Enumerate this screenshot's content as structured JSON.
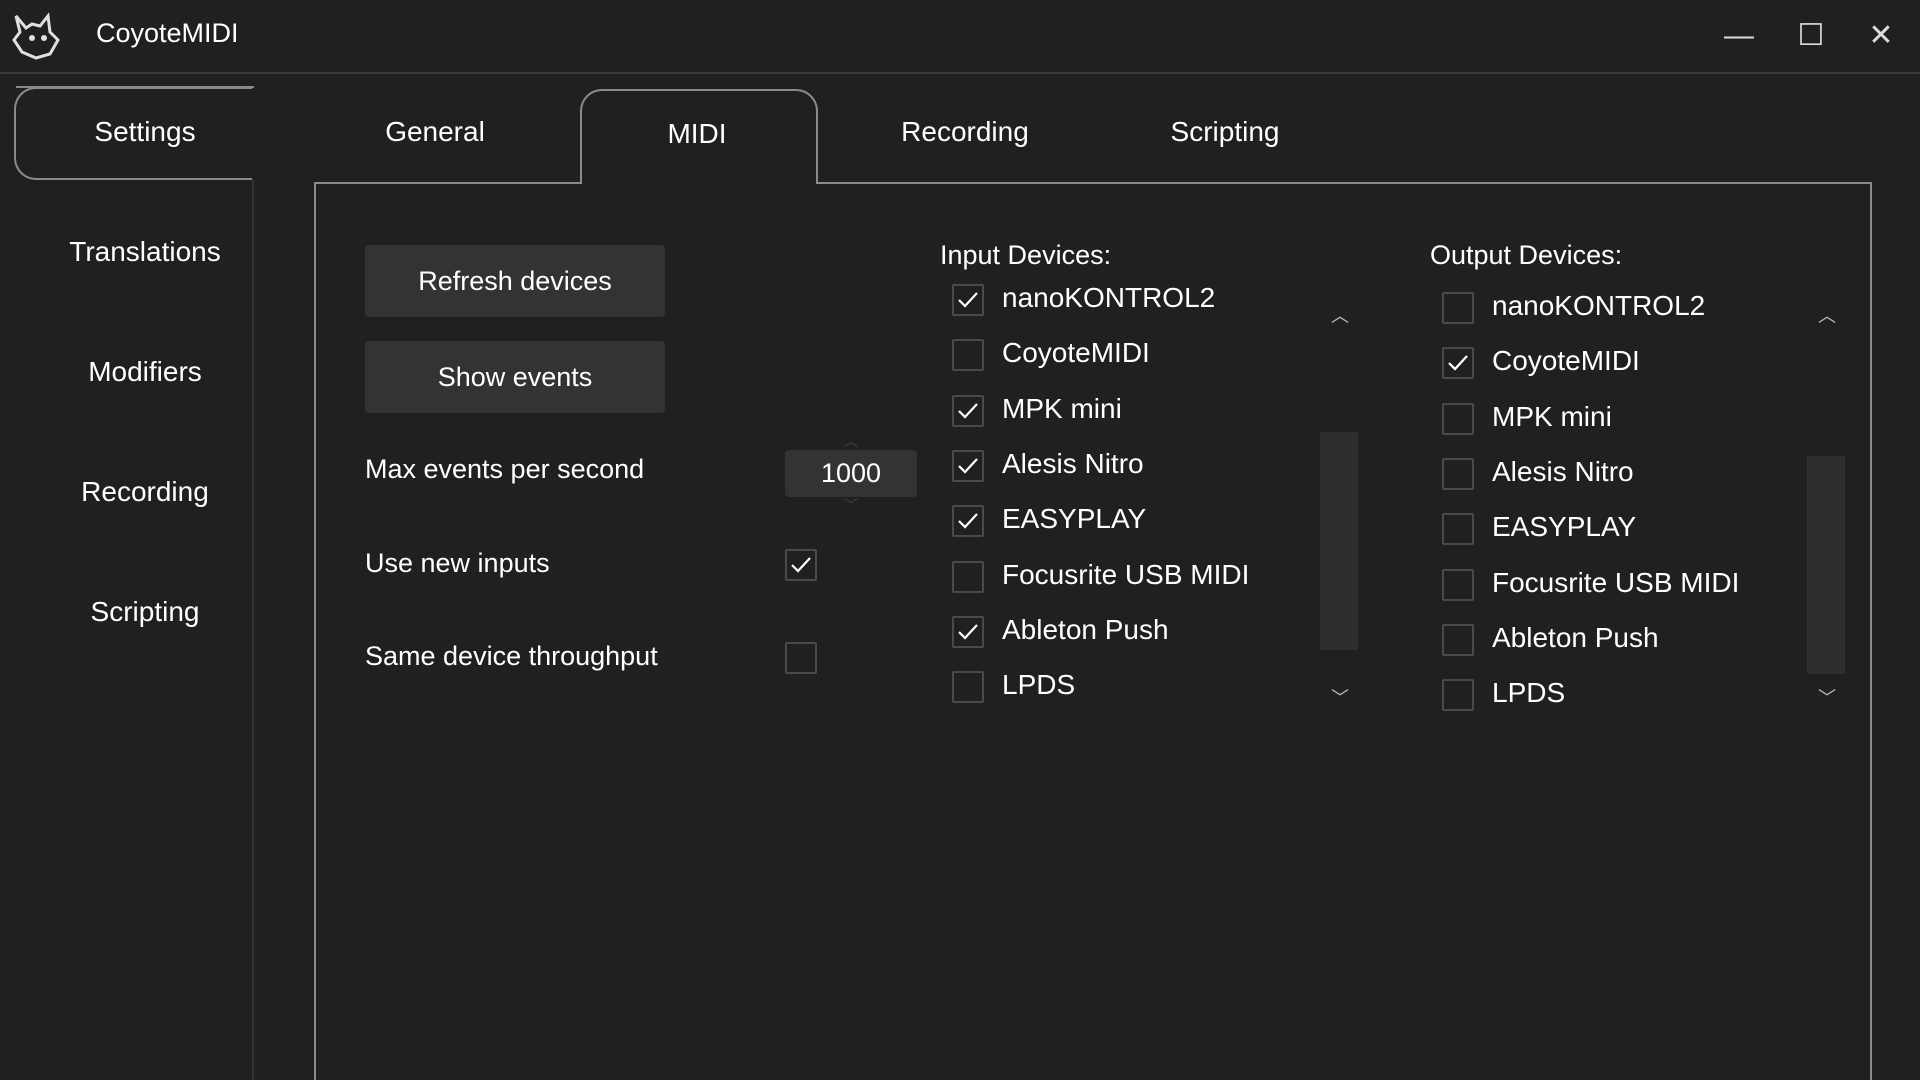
{
  "window": {
    "title": "CoyoteMIDI",
    "controls": {
      "minimize": "—",
      "maximize": "☐",
      "close": "✕"
    }
  },
  "sidebar": {
    "header": "Settings",
    "items": [
      {
        "label": "Translations"
      },
      {
        "label": "Modifiers"
      },
      {
        "label": "Recording"
      },
      {
        "label": "Scripting"
      }
    ]
  },
  "tabs": [
    {
      "label": "General",
      "active": false
    },
    {
      "label": "MIDI",
      "active": true
    },
    {
      "label": "Recording",
      "active": false
    },
    {
      "label": "Scripting",
      "active": false
    }
  ],
  "midi": {
    "refresh_label": "Refresh devices",
    "show_events_label": "Show events",
    "max_events_label": "Max events per second",
    "max_events_value": "1000",
    "use_new_inputs_label": "Use new inputs",
    "use_new_inputs_checked": true,
    "same_device_label": "Same device throughput",
    "same_device_checked": false
  },
  "input_devices": {
    "header": "Input Devices:",
    "items": [
      {
        "label": "nanoKONTROL2",
        "checked": true
      },
      {
        "label": "CoyoteMIDI",
        "checked": false
      },
      {
        "label": "MPK mini",
        "checked": true
      },
      {
        "label": "Alesis Nitro",
        "checked": true
      },
      {
        "label": "EASYPLAY",
        "checked": true
      },
      {
        "label": "Focusrite USB MIDI",
        "checked": false
      },
      {
        "label": "Ableton Push",
        "checked": true
      },
      {
        "label": "LPDS",
        "checked": false
      }
    ]
  },
  "output_devices": {
    "header": "Output Devices:",
    "items": [
      {
        "label": "nanoKONTROL2",
        "checked": false
      },
      {
        "label": "CoyoteMIDI",
        "checked": true
      },
      {
        "label": "MPK mini",
        "checked": false
      },
      {
        "label": "Alesis Nitro",
        "checked": false
      },
      {
        "label": "EASYPLAY",
        "checked": false
      },
      {
        "label": "Focusrite USB MIDI",
        "checked": false
      },
      {
        "label": "Ableton Push",
        "checked": false
      },
      {
        "label": "LPDS",
        "checked": false
      }
    ]
  },
  "icons": {
    "app_logo": "coyote-logo-icon",
    "check": "checkmark-icon",
    "scroll_up": "chevron-up-icon",
    "scroll_down": "chevron-down-icon"
  }
}
